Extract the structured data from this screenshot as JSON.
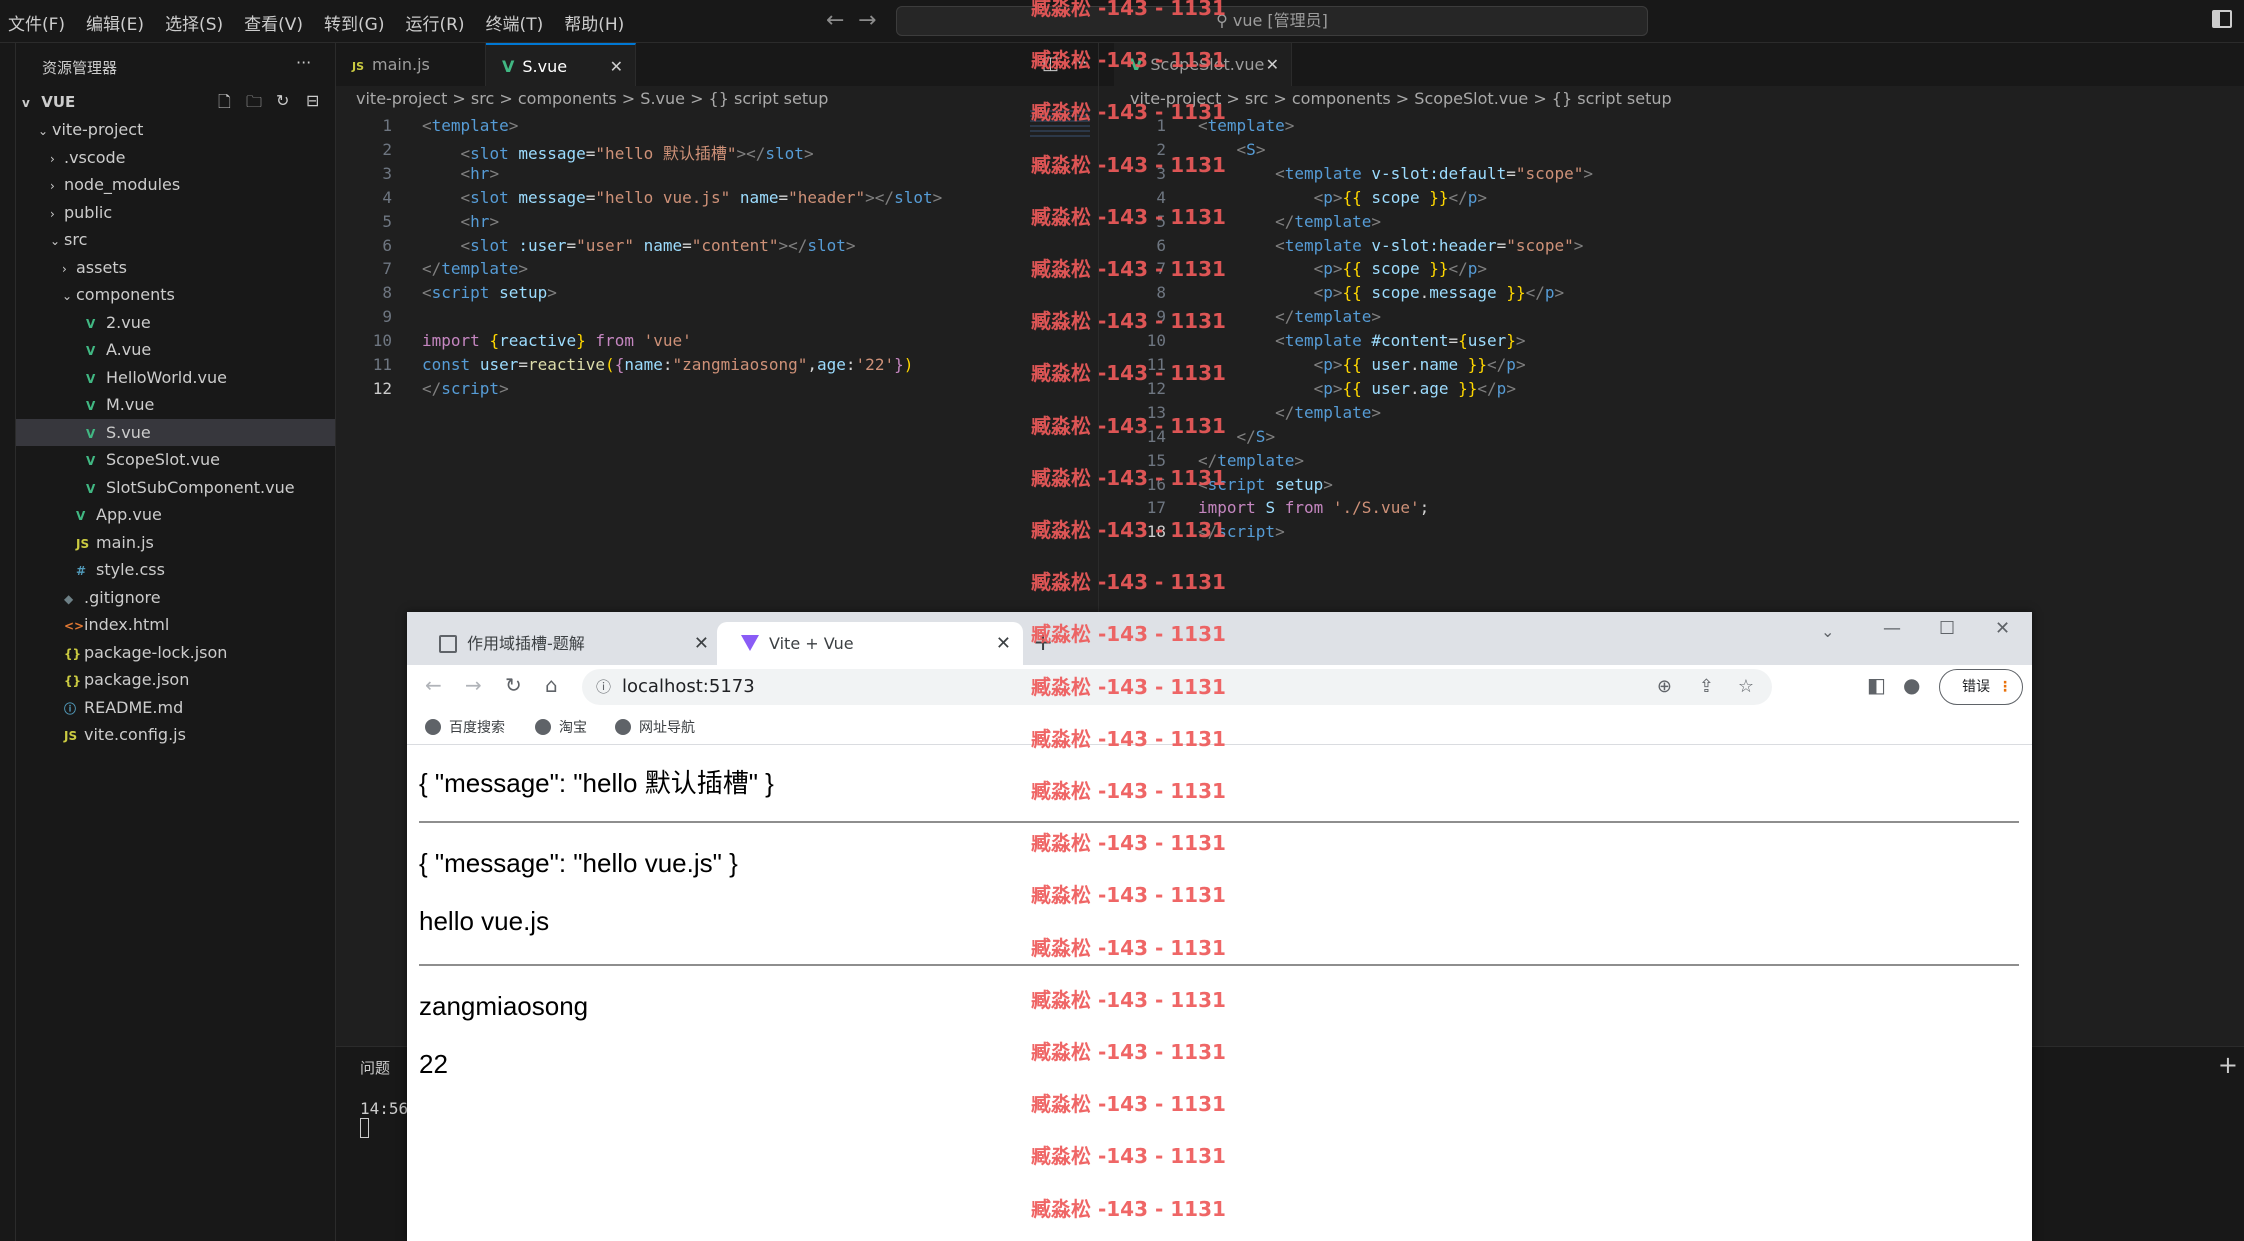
{
  "menubar": {
    "items": [
      "文件(F)",
      "编辑(E)",
      "选择(S)",
      "查看(V)",
      "转到(G)",
      "运行(R)",
      "终端(T)",
      "帮助(H)"
    ],
    "command_center": "vue [管理员]"
  },
  "sidebar": {
    "title": "资源管理器",
    "root": "VUE",
    "tree": [
      {
        "label": "vite-project",
        "indent": 1,
        "chev": "v",
        "icon": ""
      },
      {
        "label": ".vscode",
        "indent": 2,
        "chev": ">",
        "icon": ""
      },
      {
        "label": "node_modules",
        "indent": 2,
        "chev": ">",
        "icon": ""
      },
      {
        "label": "public",
        "indent": 2,
        "chev": ">",
        "icon": ""
      },
      {
        "label": "src",
        "indent": 2,
        "chev": "v",
        "icon": ""
      },
      {
        "label": "assets",
        "indent": 3,
        "chev": ">",
        "icon": ""
      },
      {
        "label": "components",
        "indent": 3,
        "chev": "v",
        "icon": ""
      },
      {
        "label": "2.vue",
        "indent": 4,
        "chev": "",
        "icon": "vue"
      },
      {
        "label": "A.vue",
        "indent": 4,
        "chev": "",
        "icon": "vue"
      },
      {
        "label": "HelloWorld.vue",
        "indent": 4,
        "chev": "",
        "icon": "vue"
      },
      {
        "label": "M.vue",
        "indent": 4,
        "chev": "",
        "icon": "vue"
      },
      {
        "label": "S.vue",
        "indent": 4,
        "chev": "",
        "icon": "vue",
        "selected": true
      },
      {
        "label": "ScopeSlot.vue",
        "indent": 4,
        "chev": "",
        "icon": "vue"
      },
      {
        "label": "SlotSubComponent.vue",
        "indent": 4,
        "chev": "",
        "icon": "vue"
      },
      {
        "label": "App.vue",
        "indent": 3,
        "chev": "",
        "icon": "vue"
      },
      {
        "label": "main.js",
        "indent": 3,
        "chev": "",
        "icon": "js"
      },
      {
        "label": "style.css",
        "indent": 3,
        "chev": "",
        "icon": "css"
      },
      {
        "label": ".gitignore",
        "indent": 2,
        "chev": "",
        "icon": "git"
      },
      {
        "label": "index.html",
        "indent": 2,
        "chev": "",
        "icon": "html"
      },
      {
        "label": "package-lock.json",
        "indent": 2,
        "chev": "",
        "icon": "json"
      },
      {
        "label": "package.json",
        "indent": 2,
        "chev": "",
        "icon": "json"
      },
      {
        "label": "README.md",
        "indent": 2,
        "chev": "",
        "icon": "info"
      },
      {
        "label": "vite.config.js",
        "indent": 2,
        "chev": "",
        "icon": "js"
      }
    ]
  },
  "icons": {
    "vue": "V",
    "js": "JS",
    "css": "#",
    "git": "◆",
    "html": "<>",
    "json": "{}",
    "info": "ⓘ"
  },
  "editor_left": {
    "tabs": [
      {
        "label": "main.js",
        "icon": "JS"
      },
      {
        "label": "S.vue",
        "icon": "V"
      }
    ],
    "breadcrumb": "vite-project  >  src  >  components  >  S.vue  >  {} script setup",
    "current_line": 12,
    "lines": [
      [
        [
          "t-br",
          "<"
        ],
        [
          "t-tag",
          "template"
        ],
        [
          "t-br",
          ">"
        ]
      ],
      [
        [
          "t-txt",
          "    "
        ],
        [
          "t-br",
          "<"
        ],
        [
          "t-tag",
          "slot"
        ],
        [
          "t-txt",
          " "
        ],
        [
          "t-at",
          "message"
        ],
        [
          "t-txt",
          "="
        ],
        [
          "t-str",
          "\"hello 默认插槽\""
        ],
        [
          "t-br",
          "></"
        ],
        [
          "t-tag",
          "slot"
        ],
        [
          "t-br",
          ">"
        ]
      ],
      [
        [
          "t-txt",
          "    "
        ],
        [
          "t-br",
          "<"
        ],
        [
          "t-tag",
          "hr"
        ],
        [
          "t-br",
          ">"
        ]
      ],
      [
        [
          "t-txt",
          "    "
        ],
        [
          "t-br",
          "<"
        ],
        [
          "t-tag",
          "slot"
        ],
        [
          "t-txt",
          " "
        ],
        [
          "t-at",
          "message"
        ],
        [
          "t-txt",
          "="
        ],
        [
          "t-str",
          "\"hello vue.js\""
        ],
        [
          "t-txt",
          " "
        ],
        [
          "t-at",
          "name"
        ],
        [
          "t-txt",
          "="
        ],
        [
          "t-str",
          "\"header\""
        ],
        [
          "t-br",
          "></"
        ],
        [
          "t-tag",
          "slot"
        ],
        [
          "t-br",
          ">"
        ]
      ],
      [
        [
          "t-txt",
          "    "
        ],
        [
          "t-br",
          "<"
        ],
        [
          "t-tag",
          "hr"
        ],
        [
          "t-br",
          ">"
        ]
      ],
      [
        [
          "t-txt",
          "    "
        ],
        [
          "t-br",
          "<"
        ],
        [
          "t-tag",
          "slot"
        ],
        [
          "t-txt",
          " "
        ],
        [
          "t-at",
          ":user"
        ],
        [
          "t-txt",
          "="
        ],
        [
          "t-str",
          "\"user\""
        ],
        [
          "t-txt",
          " "
        ],
        [
          "t-at",
          "name"
        ],
        [
          "t-txt",
          "="
        ],
        [
          "t-str",
          "\"content\""
        ],
        [
          "t-br",
          "></"
        ],
        [
          "t-tag",
          "slot"
        ],
        [
          "t-br",
          ">"
        ]
      ],
      [
        [
          "t-br",
          "</"
        ],
        [
          "t-tag",
          "template"
        ],
        [
          "t-br",
          ">"
        ]
      ],
      [
        [
          "t-br",
          "<"
        ],
        [
          "t-tag",
          "script"
        ],
        [
          "t-txt",
          " "
        ],
        [
          "t-at",
          "setup"
        ],
        [
          "t-br",
          ">"
        ]
      ],
      [],
      [
        [
          "t-kw",
          "import"
        ],
        [
          "t-txt",
          " "
        ],
        [
          "t-brace",
          "{"
        ],
        [
          "t-var",
          "reactive"
        ],
        [
          "t-brace",
          "}"
        ],
        [
          "t-txt",
          " "
        ],
        [
          "t-kw",
          "from"
        ],
        [
          "t-txt",
          " "
        ],
        [
          "t-str",
          "'vue'"
        ]
      ],
      [
        [
          "t-kw2",
          "const"
        ],
        [
          "t-txt",
          " "
        ],
        [
          "t-var",
          "user"
        ],
        [
          "t-txt",
          "="
        ],
        [
          "t-fn",
          "reactive"
        ],
        [
          "t-brace",
          "("
        ],
        [
          "t-kw",
          "{"
        ],
        [
          "t-var",
          "name"
        ],
        [
          "t-txt",
          ":"
        ],
        [
          "t-str",
          "\"zangmiaosong\""
        ],
        [
          "t-txt",
          ","
        ],
        [
          "t-var",
          "age"
        ],
        [
          "t-txt",
          ":"
        ],
        [
          "t-str",
          "'22'"
        ],
        [
          "t-kw",
          "}"
        ],
        [
          "t-brace",
          ")"
        ]
      ],
      [
        [
          "t-br",
          "</"
        ],
        [
          "t-tag",
          "script"
        ],
        [
          "t-br",
          ">"
        ]
      ]
    ]
  },
  "editor_right": {
    "tabs": [
      {
        "label": "ScopeSlot.vue",
        "icon": "V"
      }
    ],
    "breadcrumb": "vite-project  >  src  >  components  >  ScopeSlot.vue  >  {} script setup",
    "current_line": 18,
    "lines": [
      [
        [
          "t-br",
          "<"
        ],
        [
          "t-tag",
          "template"
        ],
        [
          "t-br",
          ">"
        ]
      ],
      [
        [
          "t-txt",
          "    "
        ],
        [
          "t-br",
          "<"
        ],
        [
          "t-tag",
          "S"
        ],
        [
          "t-br",
          ">"
        ]
      ],
      [
        [
          "t-txt",
          "        "
        ],
        [
          "t-br",
          "<"
        ],
        [
          "t-tag",
          "template"
        ],
        [
          "t-txt",
          " "
        ],
        [
          "t-at",
          "v-slot:default"
        ],
        [
          "t-txt",
          "="
        ],
        [
          "t-str",
          "\"scope\""
        ],
        [
          "t-br",
          ">"
        ]
      ],
      [
        [
          "t-txt",
          "            "
        ],
        [
          "t-br",
          "<"
        ],
        [
          "t-tag",
          "p"
        ],
        [
          "t-br",
          ">"
        ],
        [
          "t-brace",
          "{{"
        ],
        [
          "t-txt",
          " "
        ],
        [
          "t-var",
          "scope"
        ],
        [
          "t-txt",
          " "
        ],
        [
          "t-brace",
          "}}"
        ],
        [
          "t-br",
          "</"
        ],
        [
          "t-tag",
          "p"
        ],
        [
          "t-br",
          ">"
        ]
      ],
      [
        [
          "t-txt",
          "        "
        ],
        [
          "t-br",
          "</"
        ],
        [
          "t-tag",
          "template"
        ],
        [
          "t-br",
          ">"
        ]
      ],
      [
        [
          "t-txt",
          "        "
        ],
        [
          "t-br",
          "<"
        ],
        [
          "t-tag",
          "template"
        ],
        [
          "t-txt",
          " "
        ],
        [
          "t-at",
          "v-slot:header"
        ],
        [
          "t-txt",
          "="
        ],
        [
          "t-str",
          "\"scope\""
        ],
        [
          "t-br",
          ">"
        ]
      ],
      [
        [
          "t-txt",
          "            "
        ],
        [
          "t-br",
          "<"
        ],
        [
          "t-tag",
          "p"
        ],
        [
          "t-br",
          ">"
        ],
        [
          "t-brace",
          "{{"
        ],
        [
          "t-txt",
          " "
        ],
        [
          "t-var",
          "scope"
        ],
        [
          "t-txt",
          " "
        ],
        [
          "t-brace",
          "}}"
        ],
        [
          "t-br",
          "</"
        ],
        [
          "t-tag",
          "p"
        ],
        [
          "t-br",
          ">"
        ]
      ],
      [
        [
          "t-txt",
          "            "
        ],
        [
          "t-br",
          "<"
        ],
        [
          "t-tag",
          "p"
        ],
        [
          "t-br",
          ">"
        ],
        [
          "t-brace",
          "{{"
        ],
        [
          "t-txt",
          " "
        ],
        [
          "t-var",
          "scope"
        ],
        [
          "t-txt",
          "."
        ],
        [
          "t-var",
          "message"
        ],
        [
          "t-txt",
          " "
        ],
        [
          "t-brace",
          "}}"
        ],
        [
          "t-br",
          "</"
        ],
        [
          "t-tag",
          "p"
        ],
        [
          "t-br",
          ">"
        ]
      ],
      [
        [
          "t-txt",
          "        "
        ],
        [
          "t-br",
          "</"
        ],
        [
          "t-tag",
          "template"
        ],
        [
          "t-br",
          ">"
        ]
      ],
      [
        [
          "t-txt",
          "        "
        ],
        [
          "t-br",
          "<"
        ],
        [
          "t-tag",
          "template"
        ],
        [
          "t-txt",
          " "
        ],
        [
          "t-at",
          "#content"
        ],
        [
          "t-txt",
          "="
        ],
        [
          "t-brace",
          "{"
        ],
        [
          "t-var",
          "user"
        ],
        [
          "t-brace",
          "}"
        ],
        [
          "t-br",
          ">"
        ]
      ],
      [
        [
          "t-txt",
          "            "
        ],
        [
          "t-br",
          "<"
        ],
        [
          "t-tag",
          "p"
        ],
        [
          "t-br",
          ">"
        ],
        [
          "t-brace",
          "{{"
        ],
        [
          "t-txt",
          " "
        ],
        [
          "t-var",
          "user"
        ],
        [
          "t-txt",
          "."
        ],
        [
          "t-var",
          "name"
        ],
        [
          "t-txt",
          " "
        ],
        [
          "t-brace",
          "}}"
        ],
        [
          "t-br",
          "</"
        ],
        [
          "t-tag",
          "p"
        ],
        [
          "t-br",
          ">"
        ]
      ],
      [
        [
          "t-txt",
          "            "
        ],
        [
          "t-br",
          "<"
        ],
        [
          "t-tag",
          "p"
        ],
        [
          "t-br",
          ">"
        ],
        [
          "t-brace",
          "{{"
        ],
        [
          "t-txt",
          " "
        ],
        [
          "t-var",
          "user"
        ],
        [
          "t-txt",
          "."
        ],
        [
          "t-var",
          "age"
        ],
        [
          "t-txt",
          " "
        ],
        [
          "t-brace",
          "}}"
        ],
        [
          "t-br",
          "</"
        ],
        [
          "t-tag",
          "p"
        ],
        [
          "t-br",
          ">"
        ]
      ],
      [
        [
          "t-txt",
          "        "
        ],
        [
          "t-br",
          "</"
        ],
        [
          "t-tag",
          "template"
        ],
        [
          "t-br",
          ">"
        ]
      ],
      [
        [
          "t-txt",
          "    "
        ],
        [
          "t-br",
          "</"
        ],
        [
          "t-tag",
          "S"
        ],
        [
          "t-br",
          ">"
        ]
      ],
      [
        [
          "t-br",
          "</"
        ],
        [
          "t-tag",
          "template"
        ],
        [
          "t-br",
          ">"
        ]
      ],
      [
        [
          "t-br",
          "<"
        ],
        [
          "t-tag",
          "script"
        ],
        [
          "t-txt",
          " "
        ],
        [
          "t-at",
          "setup"
        ],
        [
          "t-br",
          ">"
        ]
      ],
      [
        [
          "t-kw",
          "import"
        ],
        [
          "t-txt",
          " "
        ],
        [
          "t-var",
          "S"
        ],
        [
          "t-txt",
          " "
        ],
        [
          "t-kw",
          "from"
        ],
        [
          "t-txt",
          " "
        ],
        [
          "t-str",
          "'./S.vue'"
        ],
        [
          "t-txt",
          ";"
        ]
      ],
      [
        [
          "t-br",
          "</"
        ],
        [
          "t-tag",
          "script"
        ],
        [
          "t-br",
          ">"
        ]
      ]
    ]
  },
  "panel": {
    "tab": "问题",
    "terminal_time": "14:56"
  },
  "browser": {
    "tabs": [
      "作用域插槽-题解",
      "Vite + Vue"
    ],
    "url": "localhost:5173",
    "error_button": "错误",
    "bookmarks": [
      "百度搜索",
      "淘宝",
      "网址导航"
    ],
    "content": {
      "line1": "{ \"message\": \"hello 默认插槽\" }",
      "line2": "{ \"message\": \"hello vue.js\" }",
      "line3": "hello vue.js",
      "line4": "zangmiaosong",
      "line5": "22"
    }
  },
  "watermark": "臧淼松 -143 - 1131"
}
